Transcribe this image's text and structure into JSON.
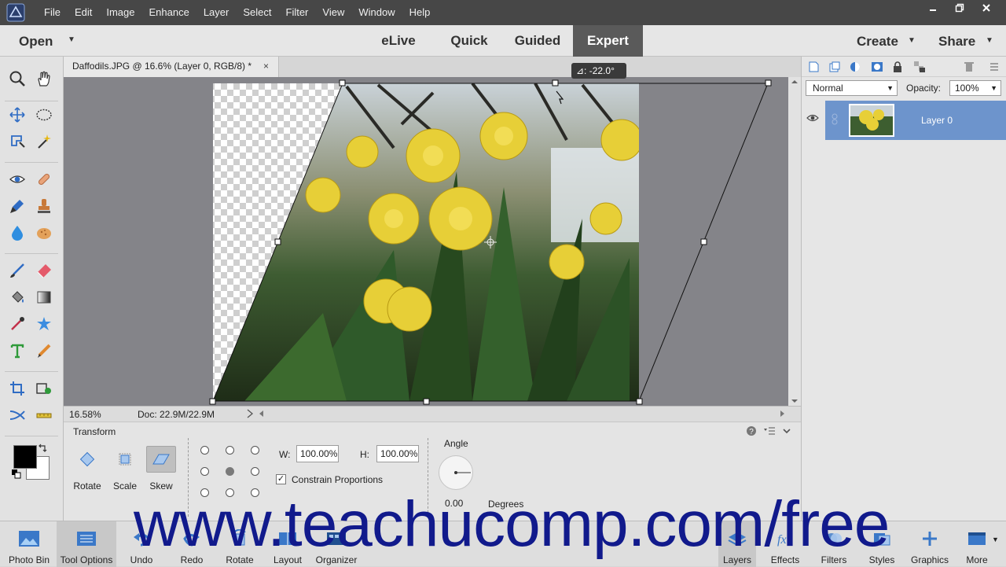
{
  "menubar": {
    "items": [
      "File",
      "Edit",
      "Image",
      "Enhance",
      "Layer",
      "Select",
      "Filter",
      "View",
      "Window",
      "Help"
    ]
  },
  "modebar": {
    "open_label": "Open",
    "tabs": [
      "eLive",
      "Quick",
      "Guided",
      "Expert"
    ],
    "active_tab": "Expert",
    "create_label": "Create",
    "share_label": "Share"
  },
  "document": {
    "tab_title": "Daffodils.JPG @ 16.6% (Layer 0, RGB/8) *",
    "close_glyph": "×",
    "angle_tooltip": "⊿: -22.0°",
    "zoom": "16.58%",
    "doc_info": "Doc: 22.9M/22.9M"
  },
  "tool_options": {
    "title": "Transform",
    "buttons": [
      {
        "label": "Rotate"
      },
      {
        "label": "Scale"
      },
      {
        "label": "Skew"
      }
    ],
    "active_button": "Skew",
    "width_label": "W:",
    "width_value": "100.00%",
    "height_label": "H:",
    "height_value": "100.00%",
    "constrain_label": "Constrain Proportions",
    "constrain_checked": true,
    "angle_label": "Angle",
    "angle_value": "0.00",
    "angle_unit": "Degrees"
  },
  "layers": {
    "blend_mode": "Normal",
    "opacity_label": "Opacity:",
    "opacity_value": "100%",
    "items": [
      {
        "name": "Layer 0"
      }
    ]
  },
  "taskbar": {
    "left": [
      "Photo Bin",
      "Tool Options",
      "Undo",
      "Redo",
      "Rotate",
      "Layout",
      "Organizer"
    ],
    "right": [
      "Layers",
      "Effects",
      "Filters",
      "Styles",
      "Graphics",
      "More"
    ]
  },
  "watermark": "www.teachucomp.com/free",
  "colors": {
    "menubar": "#474747",
    "canvas_bg": "#848489",
    "layer_selected": "#6d94cc",
    "watermark": "#111a8c"
  }
}
